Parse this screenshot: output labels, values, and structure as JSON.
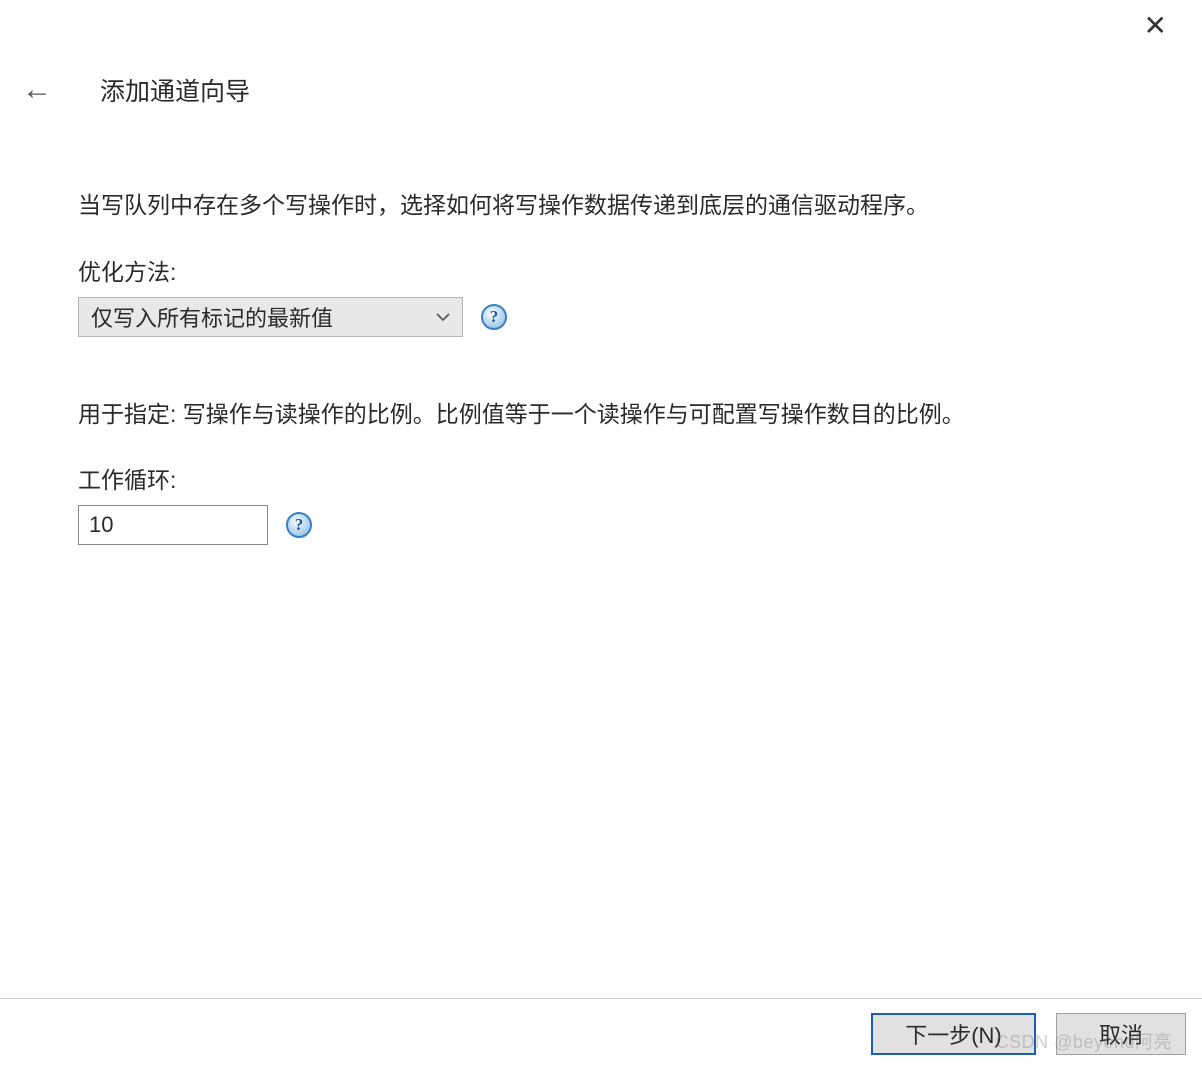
{
  "header": {
    "title": "添加通道向导"
  },
  "section1": {
    "description": "当写队列中存在多个写操作时，选择如何将写操作数据传递到底层的通信驱动程序。",
    "label": "优化方法:",
    "value": "仅写入所有标记的最新值"
  },
  "section2": {
    "description": "用于指定: 写操作与读操作的比例。比例值等于一个读操作与可配置写操作数目的比例。",
    "label": "工作循环:",
    "value": "10"
  },
  "footer": {
    "next": "下一步(N)",
    "cancel": "取消"
  },
  "icons": {
    "help": "?"
  },
  "watermark": "CSDN @beyond阿亮"
}
